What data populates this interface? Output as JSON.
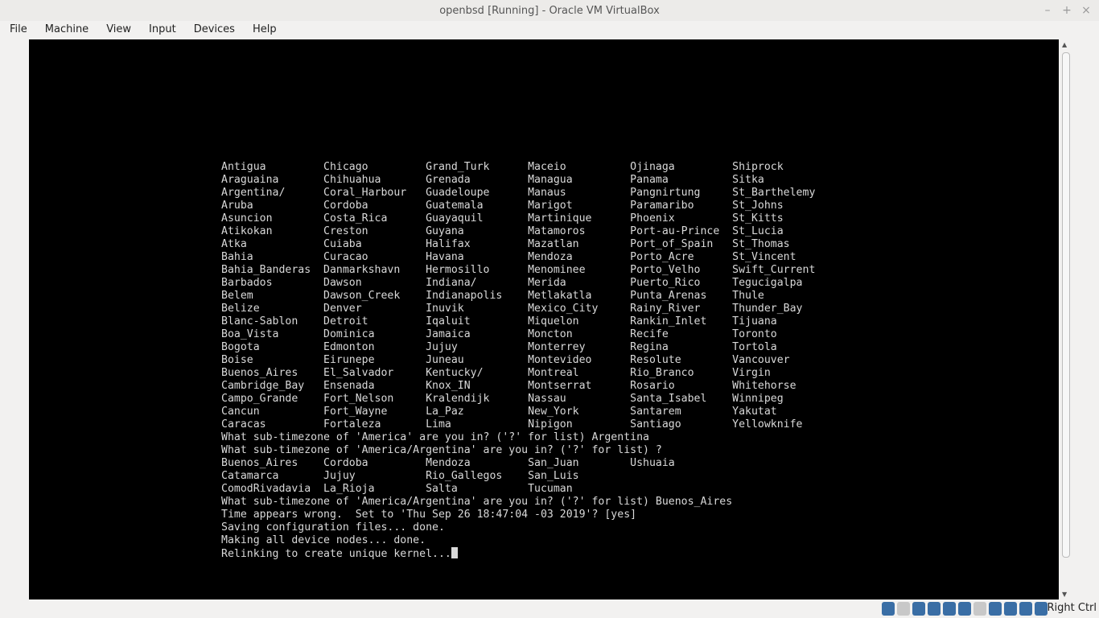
{
  "window": {
    "title": "openbsd [Running] - Oracle VM VirtualBox"
  },
  "menu": [
    "File",
    "Machine",
    "View",
    "Input",
    "Devices",
    "Help"
  ],
  "console": {
    "columns": [
      [
        "Antigua",
        "Araguaina",
        "Argentina/",
        "Aruba",
        "Asuncion",
        "Atikokan",
        "Atka",
        "Bahia",
        "Bahia_Banderas",
        "Barbados",
        "Belem",
        "Belize",
        "Blanc-Sablon",
        "Boa_Vista",
        "Bogota",
        "Boise",
        "Buenos_Aires",
        "Cambridge_Bay",
        "Campo_Grande",
        "Cancun",
        "Caracas"
      ],
      [
        "Chicago",
        "Chihuahua",
        "Coral_Harbour",
        "Cordoba",
        "Costa_Rica",
        "Creston",
        "Cuiaba",
        "Curacao",
        "Danmarkshavn",
        "Dawson",
        "Dawson_Creek",
        "Denver",
        "Detroit",
        "Dominica",
        "Edmonton",
        "Eirunepe",
        "El_Salvador",
        "Ensenada",
        "Fort_Nelson",
        "Fort_Wayne",
        "Fortaleza"
      ],
      [
        "Grand_Turk",
        "Grenada",
        "Guadeloupe",
        "Guatemala",
        "Guayaquil",
        "Guyana",
        "Halifax",
        "Havana",
        "Hermosillo",
        "Indiana/",
        "Indianapolis",
        "Inuvik",
        "Iqaluit",
        "Jamaica",
        "Jujuy",
        "Juneau",
        "Kentucky/",
        "Knox_IN",
        "Kralendijk",
        "La_Paz",
        "Lima"
      ],
      [
        "Maceio",
        "Managua",
        "Manaus",
        "Marigot",
        "Martinique",
        "Matamoros",
        "Mazatlan",
        "Mendoza",
        "Menominee",
        "Merida",
        "Metlakatla",
        "Mexico_City",
        "Miquelon",
        "Moncton",
        "Monterrey",
        "Montevideo",
        "Montreal",
        "Montserrat",
        "Nassau",
        "New_York",
        "Nipigon"
      ],
      [
        "Ojinaga",
        "Panama",
        "Pangnirtung",
        "Paramaribo",
        "Phoenix",
        "Port-au-Prince",
        "Port_of_Spain",
        "Porto_Acre",
        "Porto_Velho",
        "Puerto_Rico",
        "Punta_Arenas",
        "Rainy_River",
        "Rankin_Inlet",
        "Recife",
        "Regina",
        "Resolute",
        "Rio_Branco",
        "Rosario",
        "Santa_Isabel",
        "Santarem",
        "Santiago"
      ],
      [
        "Shiprock",
        "Sitka",
        "St_Barthelemy",
        "St_Johns",
        "St_Kitts",
        "St_Lucia",
        "St_Thomas",
        "St_Vincent",
        "Swift_Current",
        "Tegucigalpa",
        "Thule",
        "Thunder_Bay",
        "Tijuana",
        "Toronto",
        "Tortola",
        "Vancouver",
        "Virgin",
        "Whitehorse",
        "Winnipeg",
        "Yakutat",
        "Yellowknife"
      ]
    ],
    "prompt1": "What sub-timezone of 'America' are you in? ('?' for list) Argentina",
    "prompt2": "What sub-timezone of 'America/Argentina' are you in? ('?' for list) ?",
    "argentina_columns": [
      [
        "Buenos_Aires",
        "Catamarca",
        "ComodRivadavia"
      ],
      [
        "Cordoba",
        "Jujuy",
        "La_Rioja"
      ],
      [
        "Mendoza",
        "Rio_Gallegos",
        "Salta"
      ],
      [
        "San_Juan",
        "San_Luis",
        "Tucuman"
      ],
      [
        "Ushuaia"
      ]
    ],
    "prompt3": "What sub-timezone of 'America/Argentina' are you in? ('?' for list) Buenos_Aires",
    "time_line": "Time appears wrong.  Set to 'Thu Sep 26 18:47:04 -03 2019'? [yes]",
    "saving_line": "Saving configuration files... done.",
    "devices_line": "Making all device nodes... done.",
    "relink_line": "Relinking to create unique kernel..."
  },
  "statusbar": {
    "icons": [
      "hard-disk-icon",
      "optical-drive-icon",
      "audio-icon",
      "network-icon",
      "usb-icon",
      "shared-folders-icon",
      "display-icon",
      "video-capture-icon",
      "cpu-icon",
      "mouse-integration-icon",
      "keyboard-icon"
    ],
    "host_key": "Right Ctrl"
  }
}
